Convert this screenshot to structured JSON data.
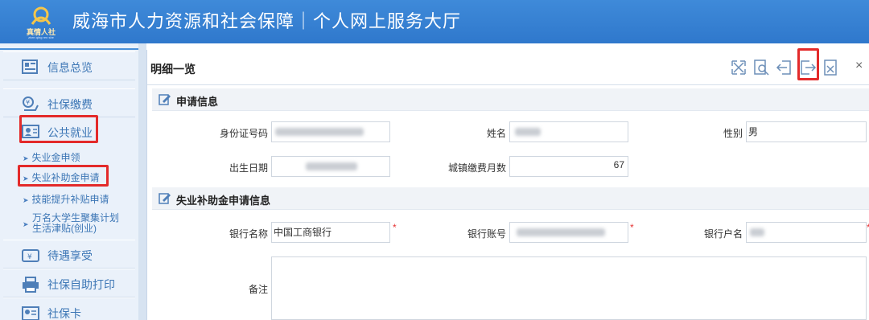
{
  "header": {
    "logo_text": "真情人社",
    "logo_sub": "zhen qing ren she",
    "title": "威海市人力资源和社会保障｜个人网上服务大厅"
  },
  "sidebar": {
    "items": [
      {
        "label": "信息总览",
        "icon": "overview-icon"
      },
      {
        "label": "社保缴费",
        "icon": "payment-icon"
      },
      {
        "label": "公共就业",
        "icon": "employment-icon"
      },
      {
        "label": "待遇享受",
        "icon": "benefit-icon"
      },
      {
        "label": "社保自助打印",
        "icon": "printer-icon"
      },
      {
        "label": "社保卡",
        "icon": "card-icon"
      }
    ],
    "sub_items": [
      {
        "label": "失业金申领"
      },
      {
        "label": "失业补助金申请"
      },
      {
        "label": "技能提升补贴申请"
      },
      {
        "label_line1": "万名大学生聚集计划",
        "label_line2": "生活津贴(创业)"
      }
    ]
  },
  "main": {
    "title": "明细一览",
    "close": "×",
    "section1": {
      "title": "申请信息"
    },
    "section2": {
      "title": "失业补助金申请信息"
    },
    "fields": {
      "id_label": "身份证号码",
      "name_label": "姓名",
      "gender_label": "性别",
      "gender_value": "男",
      "birth_label": "出生日期",
      "months_label": "城镇缴费月数",
      "months_value": "67",
      "bank_label": "银行名称",
      "bank_value": "中国工商银行",
      "account_label": "银行账号",
      "account_name_label": "银行户名",
      "remark_label": "备注",
      "required_mark": "*"
    }
  },
  "colors": {
    "header_blue": "#3583d3",
    "link_blue": "#3c76b5",
    "highlight_red": "#e32a2a"
  }
}
